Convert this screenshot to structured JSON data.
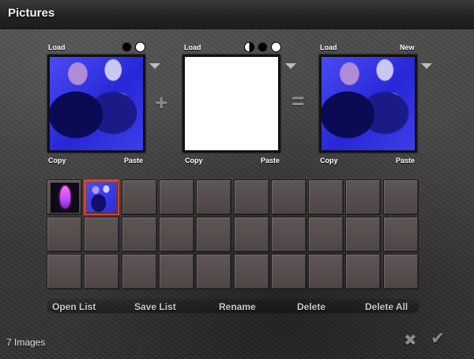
{
  "window": {
    "title": "Pictures"
  },
  "slots": [
    {
      "top_label": "Load",
      "top_right_label": "",
      "copy_label": "Copy",
      "paste_label": "Paste"
    },
    {
      "top_label": "Load",
      "top_right_label": "",
      "copy_label": "Copy",
      "paste_label": "Paste"
    },
    {
      "top_label": "Load",
      "top_right_label": "New",
      "copy_label": "Copy",
      "paste_label": "Paste"
    }
  ],
  "operators": {
    "plus": "+",
    "equals": "="
  },
  "icons": {
    "dropdown": "chevron-down-icon",
    "cancel": "close-icon",
    "confirm": "checkmark-icon"
  },
  "colors": {
    "selection_border": "#e23b3b",
    "image_tint": "#3a3ae6"
  },
  "list_buttons": {
    "open": "Open List",
    "save": "Save List",
    "rename": "Rename",
    "delete": "Delete",
    "delete_all": "Delete All"
  },
  "status": {
    "count_text": "7 Images"
  },
  "glyphs": {
    "cancel": "✖",
    "confirm": "✔"
  }
}
